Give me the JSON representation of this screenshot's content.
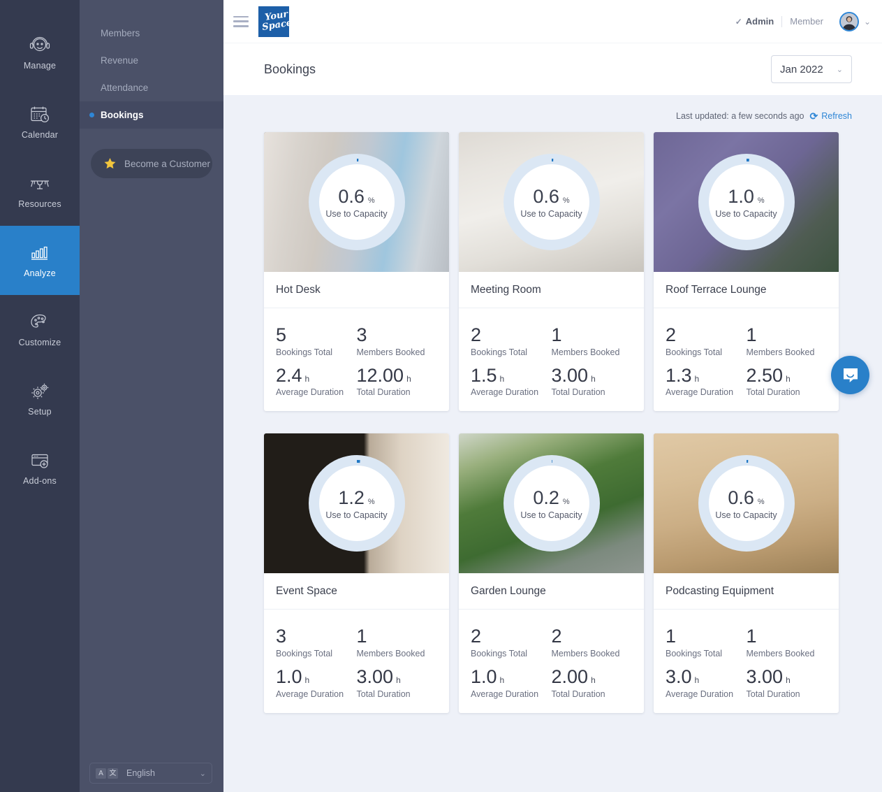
{
  "rail": {
    "items": [
      {
        "label": "Manage",
        "icon": "headset-icon",
        "active": false
      },
      {
        "label": "Calendar",
        "icon": "calendar-clock-icon",
        "active": false
      },
      {
        "label": "Resources",
        "icon": "desk-icon",
        "active": false
      },
      {
        "label": "Analyze",
        "icon": "bar-chart-icon",
        "active": true
      },
      {
        "label": "Customize",
        "icon": "palette-icon",
        "active": false
      },
      {
        "label": "Setup",
        "icon": "gears-icon",
        "active": false
      },
      {
        "label": "Add-ons",
        "icon": "browser-plus-icon",
        "active": false
      }
    ]
  },
  "subnav": {
    "items": [
      {
        "label": "Members",
        "active": false
      },
      {
        "label": "Revenue",
        "active": false
      },
      {
        "label": "Attendance",
        "active": false
      },
      {
        "label": "Bookings",
        "active": true
      }
    ],
    "cta_label": "Become a Customer",
    "cta_icon": "star-icon",
    "language": {
      "value": "English",
      "icon": "translate-icon",
      "glyph_a": "A",
      "glyph_b": "文",
      "chevron": "⌄"
    }
  },
  "topbar": {
    "menu_icon": "hamburger-menu-icon",
    "logo_line1": "Your",
    "logo_line2": "Space",
    "role_admin": "Admin",
    "role_admin_check": "✓",
    "role_member": "Member",
    "avatar_icon": "user-avatar",
    "chevron": "⌄"
  },
  "header": {
    "title": "Bookings",
    "period": "Jan 2022",
    "period_chevron": "⌄"
  },
  "status": {
    "last_updated": "Last updated: a few seconds ago",
    "refresh_icon": "refresh-icon",
    "refresh_glyph": "⟳",
    "refresh_label": "Refresh"
  },
  "labels": {
    "capacity": "Use to Capacity",
    "percent": "%",
    "hour": "h",
    "bookings_total": "Bookings Total",
    "members_booked": "Members Booked",
    "average_duration": "Average Duration",
    "total_duration": "Total Duration"
  },
  "colors": {
    "accent": "#2980c9",
    "rail_bg": "#343a4f",
    "subnav_bg": "#4b5168",
    "page_bg": "#eef1f8",
    "gauge_track": "#dbe7f4",
    "gauge_fill": "#1f77c4",
    "star": "#f2c53d"
  },
  "chat": {
    "icon": "intercom-chat-icon"
  },
  "cards": [
    {
      "name": "Hot Desk",
      "capacity_value": "0.6",
      "capacity_pct": 0.6,
      "image": "office-pink-booths",
      "bookings_total": "5",
      "members_booked": "3",
      "average_duration": "2.4",
      "total_duration": "12.00"
    },
    {
      "name": "Meeting Room",
      "capacity_value": "0.6",
      "capacity_pct": 0.6,
      "image": "workshop-desk-sketching",
      "bookings_total": "2",
      "members_booked": "1",
      "average_duration": "1.5",
      "total_duration": "3.00"
    },
    {
      "name": "Roof Terrace Lounge",
      "capacity_value": "1.0",
      "capacity_pct": 1.0,
      "image": "purple-wall-plants",
      "bookings_total": "2",
      "members_booked": "1",
      "average_duration": "1.3",
      "total_duration": "2.50"
    },
    {
      "name": "Event Space",
      "capacity_value": "1.2",
      "capacity_pct": 1.2,
      "image": "dark-signage-coworking",
      "bookings_total": "3",
      "members_booked": "1",
      "average_duration": "1.0",
      "total_duration": "3.00"
    },
    {
      "name": "Garden Lounge",
      "capacity_value": "0.2",
      "capacity_pct": 0.2,
      "image": "garden-pergola-seating",
      "bookings_total": "2",
      "members_booked": "2",
      "average_duration": "1.0",
      "total_duration": "2.00"
    },
    {
      "name": "Podcasting Equipment",
      "capacity_value": "0.6",
      "capacity_pct": 0.6,
      "image": "podcast-mic-wood-panel",
      "bookings_total": "1",
      "members_booked": "1",
      "average_duration": "3.0",
      "total_duration": "3.00"
    }
  ]
}
